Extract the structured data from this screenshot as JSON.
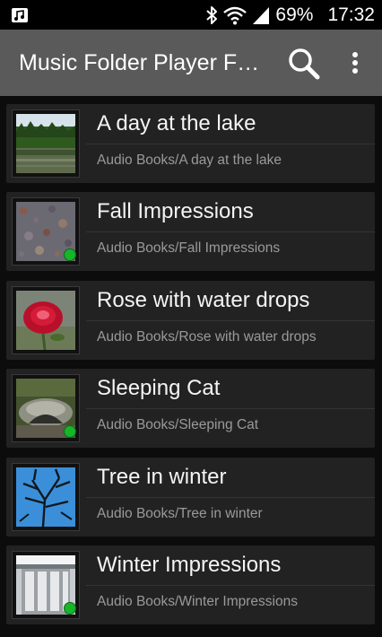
{
  "status_bar": {
    "battery": "69%",
    "time": "17:32",
    "icons": [
      "music-note-icon",
      "bluetooth-icon",
      "wifi-icon",
      "signal-icon",
      "battery-icon"
    ]
  },
  "action_bar": {
    "title": "Music Folder Player F…",
    "icons": [
      "search-icon",
      "overflow-menu-icon"
    ]
  },
  "colors": {
    "action_bar": "#5a5a5a",
    "card": "#222222",
    "played_indicator": "#17b52a"
  },
  "folders": [
    {
      "title": "A day at the lake",
      "path": "Audio Books/A day at the lake",
      "played": false,
      "thumb": "lake"
    },
    {
      "title": "Fall Impressions",
      "path": "Audio Books/Fall Impressions",
      "played": true,
      "thumb": "fall"
    },
    {
      "title": "Rose with water drops",
      "path": "Audio Books/Rose with water drops",
      "played": false,
      "thumb": "rose"
    },
    {
      "title": "Sleeping Cat",
      "path": "Audio Books/Sleeping Cat",
      "played": true,
      "thumb": "cat"
    },
    {
      "title": "Tree in winter",
      "path": "Audio Books/Tree in winter",
      "played": false,
      "thumb": "tree"
    },
    {
      "title": "Winter Impressions",
      "path": "Audio Books/Winter Impressions",
      "played": true,
      "thumb": "winter"
    }
  ]
}
